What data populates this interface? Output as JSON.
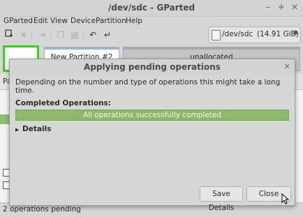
{
  "window": {
    "title": "/dev/sdc - GParted"
  },
  "menubar": [
    "GParted",
    "Edit",
    "View",
    "Device",
    "Partition",
    "Help"
  ],
  "device_selector": {
    "device": "/dev/sdc",
    "size": "(14.91 GiB)"
  },
  "partition_map": {
    "segments": [
      {
        "label": ""
      },
      {
        "label": "New Partition #2"
      },
      {
        "label": "unallocated"
      }
    ]
  },
  "list": {
    "header_partial": "Pa"
  },
  "status": {
    "text": "2 operations pending"
  },
  "dialog": {
    "title": "Applying pending operations",
    "description": "Depending on the number and type of operations this might take a long time.",
    "completed_label": "Completed Operations:",
    "progress_text": "All operations successfully completed",
    "progress_fraction": 1.0,
    "details_label": "Details",
    "save_button": "Save Details",
    "close_button": "Close"
  },
  "colors": {
    "progress_fill": "#8dba68",
    "selected_partition_border": "#38d418",
    "partition_border": "#9fb4cc",
    "unallocated": "#c5c5c5"
  }
}
